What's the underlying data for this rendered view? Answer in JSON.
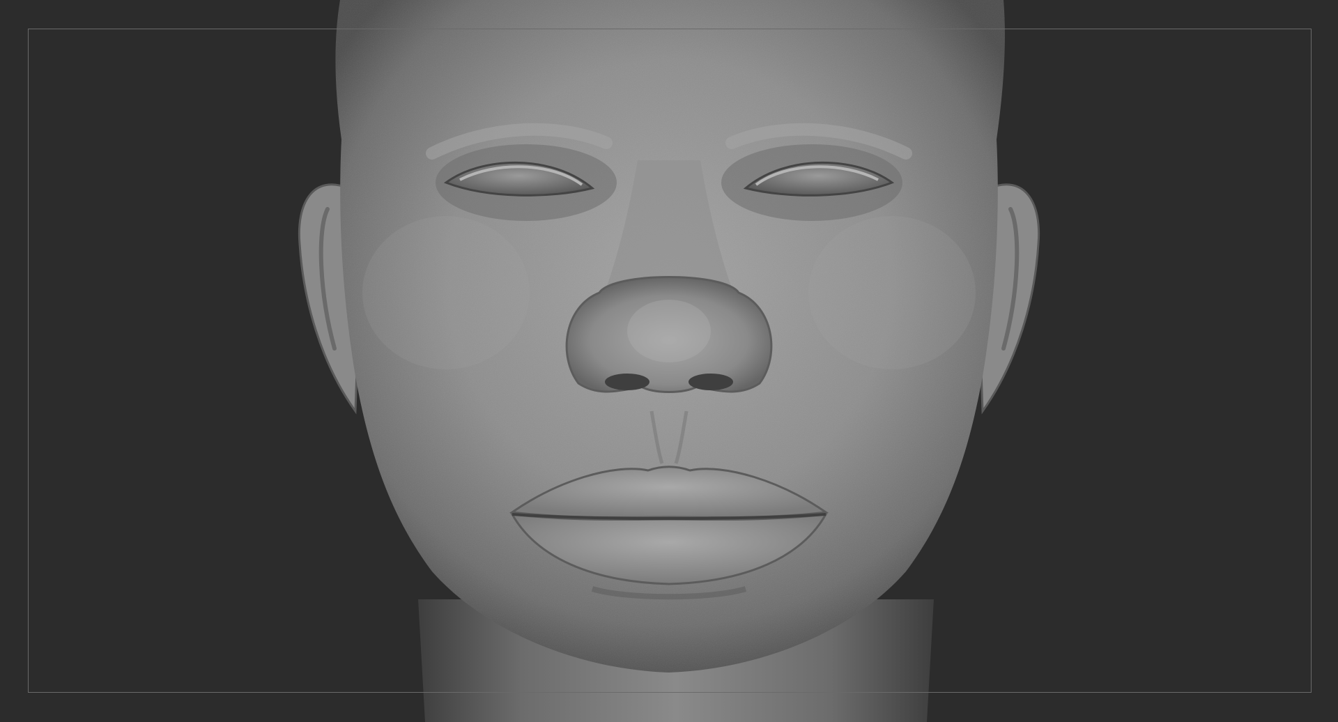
{
  "app": {
    "view": "3d-viewport",
    "background_color": "#2c2c2c",
    "frame_guide_color": "#6a6a6a"
  },
  "model": {
    "subject": "sculpted head",
    "material_color": "#8f8f8f",
    "highlight_color": "#b8b8b8",
    "shadow_color": "#4a4a4a"
  }
}
